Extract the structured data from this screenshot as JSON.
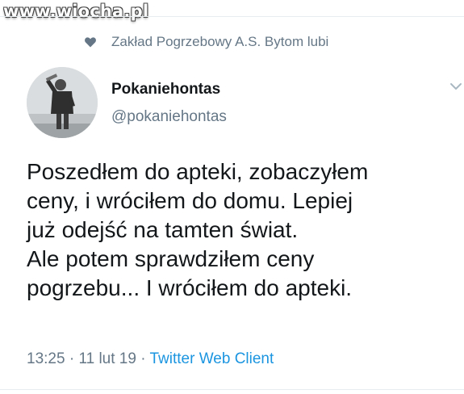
{
  "watermark": "www.wiocha.pl",
  "social_context": {
    "icon": "heart-icon",
    "text": "Zakład Pogrzebowy A.S. Bytom lubi"
  },
  "author": {
    "name": "Pokaniehontas",
    "handle": "@pokaniehontas",
    "avatar_icon": "man-drinking-avatar"
  },
  "tweet": {
    "lines": [
      "Poszedłem do apteki, zobaczyłem",
      "ceny, i wróciłem do domu. Lepiej",
      "już odejść na tamten świat.",
      "Ale potem sprawdziłem ceny",
      "pogrzebu... I wróciłem do apteki."
    ]
  },
  "meta": {
    "time": "13:25",
    "date": "11 lut 19",
    "client": "Twitter Web Client",
    "separator": " · "
  },
  "colors": {
    "text": "#14171a",
    "secondary": "#657786",
    "link": "#1b95e0",
    "divider": "#e6ecf0"
  }
}
